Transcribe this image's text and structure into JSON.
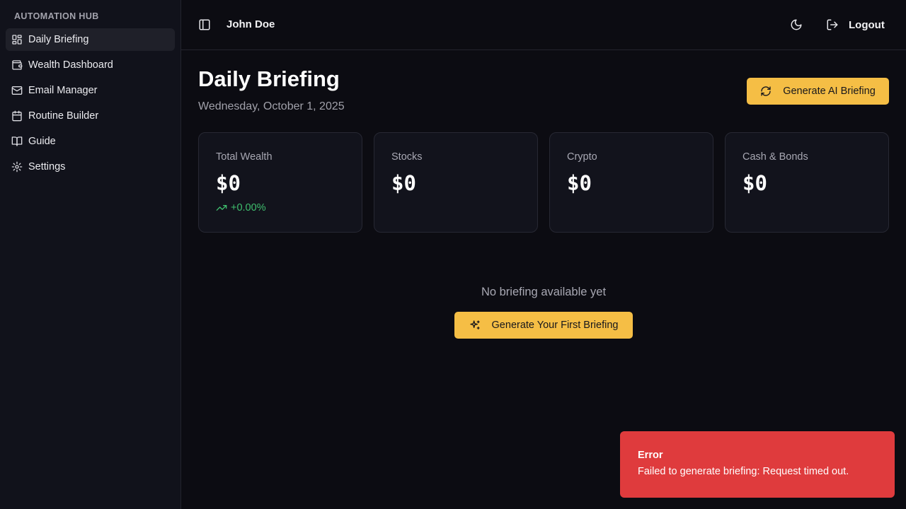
{
  "sidebar": {
    "group_label": "AUTOMATION HUB",
    "items": [
      {
        "label": "Daily Briefing",
        "icon": "layout-dashboard-icon",
        "active": true
      },
      {
        "label": "Wealth Dashboard",
        "icon": "wallet-icon",
        "active": false
      },
      {
        "label": "Email Manager",
        "icon": "mail-icon",
        "active": false
      },
      {
        "label": "Routine Builder",
        "icon": "calendar-icon",
        "active": false
      },
      {
        "label": "Guide",
        "icon": "book-open-icon",
        "active": false
      },
      {
        "label": "Settings",
        "icon": "gear-icon",
        "active": false
      }
    ]
  },
  "header": {
    "user_name": "John Doe",
    "logout_label": "Logout"
  },
  "main": {
    "title": "Daily Briefing",
    "date": "Wednesday, October 1, 2025",
    "generate_button_label": "Generate AI Briefing",
    "cards": [
      {
        "label": "Total Wealth",
        "value": "$0",
        "change": "+0.00%"
      },
      {
        "label": "Stocks",
        "value": "$0"
      },
      {
        "label": "Crypto",
        "value": "$0"
      },
      {
        "label": "Cash & Bonds",
        "value": "$0"
      }
    ],
    "empty_state": {
      "text": "No briefing available yet",
      "button_label": "Generate Your First Briefing"
    }
  },
  "toast": {
    "title": "Error",
    "message": "Failed to generate briefing: Request timed out."
  },
  "colors": {
    "accent": "#f5be45",
    "background": "#0c0c12",
    "sidebar": "#11121b",
    "positive": "#3fbf6e",
    "error": "#df3b3d"
  }
}
